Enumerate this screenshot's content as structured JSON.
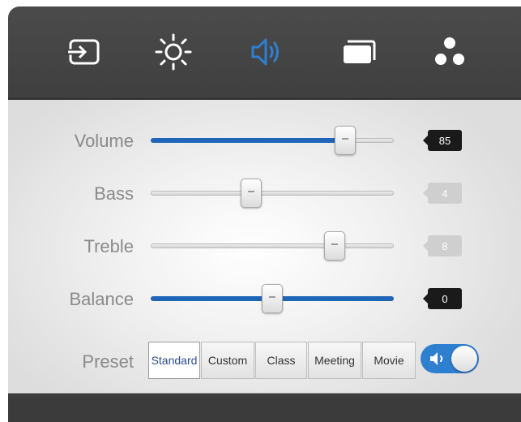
{
  "colors": {
    "accent": "#2f7fd1",
    "fill": "#1f66b8",
    "topbar": "#444444",
    "inactive_icon": "#ffffff"
  },
  "tabs": [
    {
      "icon": "input-source-icon",
      "active": false
    },
    {
      "icon": "brightness-icon",
      "active": false
    },
    {
      "icon": "sound-icon",
      "active": true
    },
    {
      "icon": "screen-icon",
      "active": false
    },
    {
      "icon": "more-dots-icon",
      "active": false
    }
  ],
  "sliders": {
    "volume": {
      "label": "Volume",
      "value": "85",
      "level": 85,
      "active": true
    },
    "bass": {
      "label": "Bass",
      "value": "4",
      "level": 40,
      "active": false
    },
    "treble": {
      "label": "Treble",
      "value": "8",
      "level": 80,
      "active": false
    },
    "balance": {
      "label": "Balance",
      "value": "0",
      "level": 50,
      "active": true
    }
  },
  "preset": {
    "label": "Preset",
    "options": [
      "Standard",
      "Custom",
      "Class",
      "Meeting",
      "Movie"
    ],
    "selected": "Standard",
    "toggle_icon": "speaker-icon",
    "toggle_on": true
  }
}
